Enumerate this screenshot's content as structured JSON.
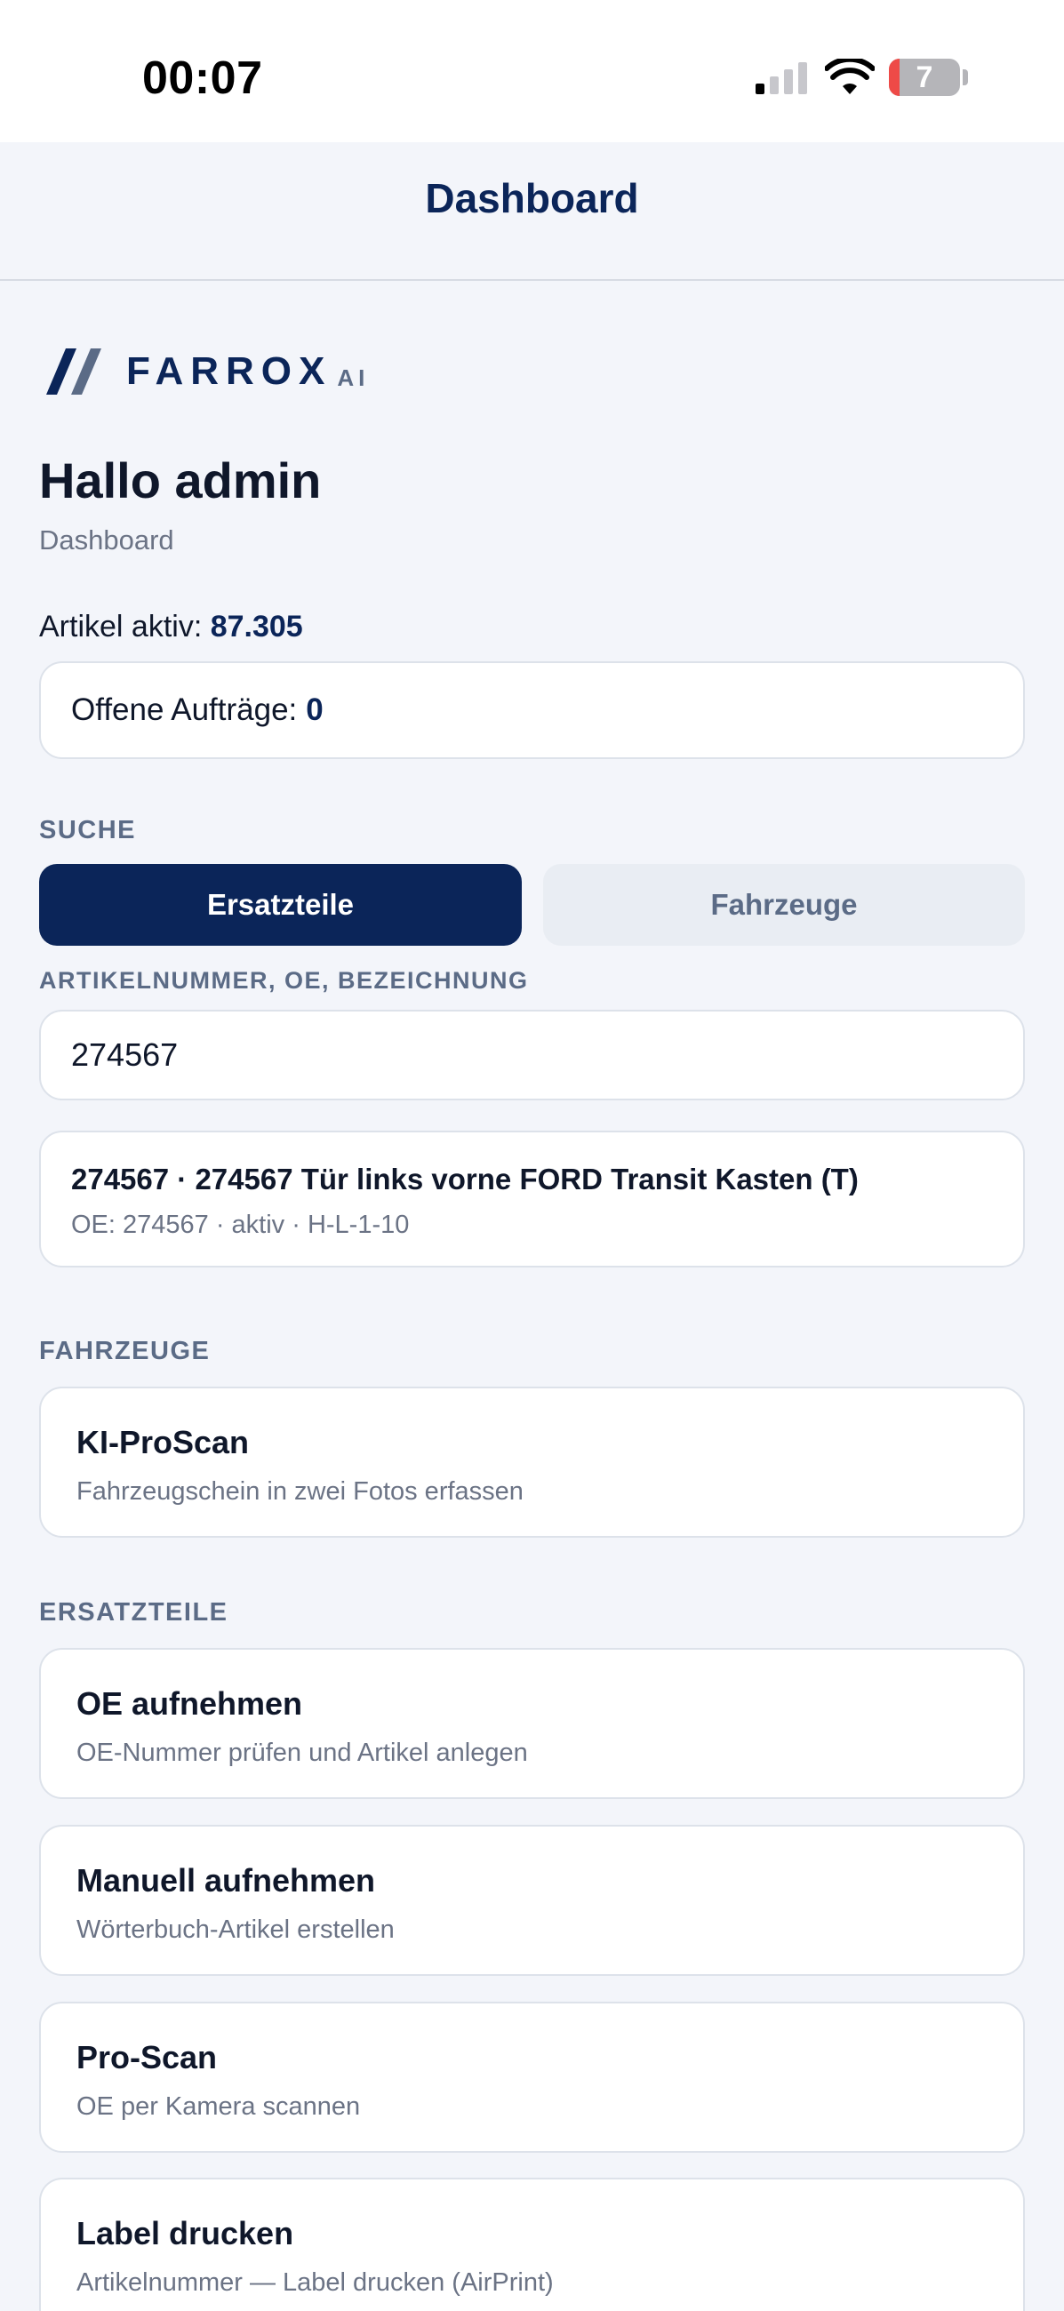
{
  "status_bar": {
    "time": "00:07",
    "battery_level": "7",
    "battery_fraction": 0.07
  },
  "nav": {
    "title": "Dashboard"
  },
  "brand": {
    "name": "FARROX",
    "suffix": "AI"
  },
  "header": {
    "greeting": "Hallo admin",
    "subtitle": "Dashboard"
  },
  "stats": {
    "articles_label": "Artikel aktiv:",
    "articles_value": "87.305",
    "open_orders_label": "Offene Aufträge:",
    "open_orders_value": "0"
  },
  "search": {
    "section_label": "SUCHE",
    "tabs": [
      {
        "label": "Ersatzteile",
        "active": true
      },
      {
        "label": "Fahrzeuge",
        "active": false
      }
    ],
    "field_label": "ARTIKELNUMMER, OE, BEZEICHNUNG",
    "value": "274567",
    "result": {
      "title": "274567 · 274567 Tür links vorne FORD Transit Kasten (T)",
      "subtitle": "OE: 274567 · aktiv · H-L-1-10"
    }
  },
  "vehicles": {
    "section_label": "FAHRZEUGE",
    "items": [
      {
        "title": "KI-ProScan",
        "subtitle": "Fahrzeugschein in zwei Fotos erfassen"
      }
    ]
  },
  "parts": {
    "section_label": "ERSATZTEILE",
    "items": [
      {
        "title": "OE aufnehmen",
        "subtitle": "OE-Nummer prüfen und Artikel anlegen"
      },
      {
        "title": "Manuell aufnehmen",
        "subtitle": "Wörterbuch-Artikel erstellen"
      },
      {
        "title": "Pro-Scan",
        "subtitle": "OE per Kamera scannen"
      },
      {
        "title": "Label drucken",
        "subtitle": "Artikelnummer — Label drucken (AirPrint)"
      }
    ]
  },
  "colors": {
    "brand": "#0b2559",
    "background": "#f3f5fa",
    "muted": "#6b7385",
    "battery_low": "#ee4a47"
  },
  "icons": [
    "signal-icon",
    "wifi-icon",
    "battery-icon",
    "farrox-logo-mark"
  ]
}
